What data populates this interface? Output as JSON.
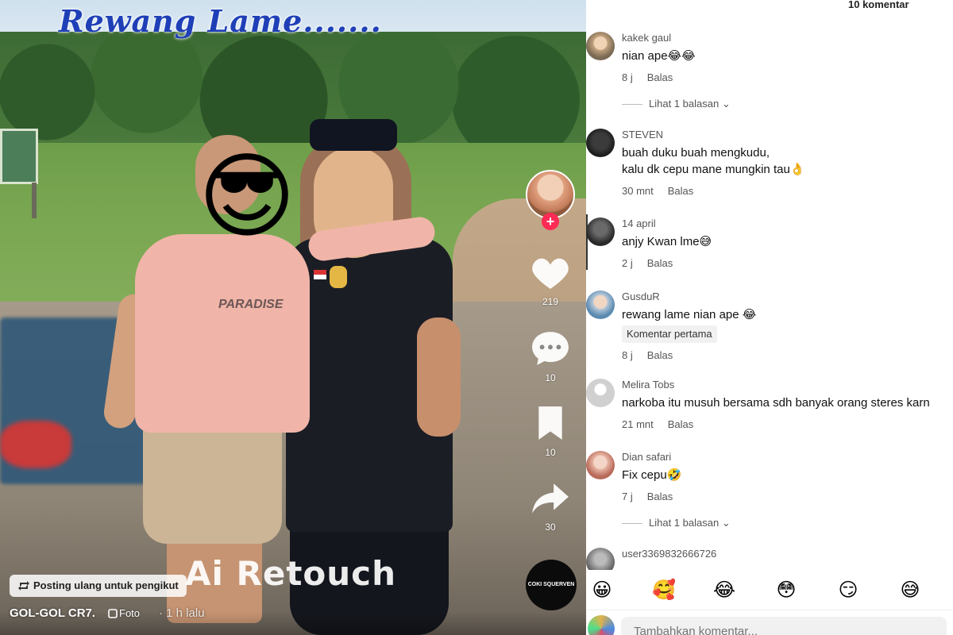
{
  "video": {
    "caption": "Rewang Lame.......",
    "watermark": "Ai Retouch",
    "author": "GOL-GOL CR7.",
    "post_type": "Foto",
    "time_ago": "1 h lalu",
    "repost_label": "Posting ulang untuk pengikut",
    "music_disc_label": "COKI SQUERVEN",
    "shirt_text": "PARADISE",
    "actions": {
      "likes": "219",
      "comments": "10",
      "saves": "10",
      "shares": "30"
    },
    "colors": {
      "caption": "#1f3fb7",
      "follow_plus": "#fe2c55"
    }
  },
  "comments_panel": {
    "count_label": "10 komentar",
    "reply_label": "Balas",
    "view_replies_label": "Lihat 1 balasan",
    "input_placeholder": "Tambahkan komentar...",
    "emoji_bar": [
      "😀",
      "🥰",
      "😂",
      "😳",
      "😏",
      "😅"
    ],
    "comments": [
      {
        "user": "kakek gaul",
        "text": "nian ape😂😂",
        "time": "8 j",
        "has_replies": true
      },
      {
        "user": "STEVEN",
        "text_lines": [
          "buah duku buah mengkudu,",
          "kalu dk cepu mane mungkin tau👌"
        ],
        "time": "30 mnt"
      },
      {
        "user": "14 april",
        "text": "anjy Kwan lme😅",
        "time": "2 j"
      },
      {
        "user": "GusduR",
        "text": "rewang lame nian ape 😂",
        "badge": "Komentar pertama",
        "time": "8 j"
      },
      {
        "user": "Melira Tobs",
        "text": "narkoba itu musuh bersama sdh banyak orang steres karn",
        "time": "21 mnt"
      },
      {
        "user": "Dian safari",
        "text": "Fix cepu🤣",
        "time": "7 j",
        "has_replies": true
      },
      {
        "user": "user3369832666726",
        "text": ""
      }
    ]
  }
}
